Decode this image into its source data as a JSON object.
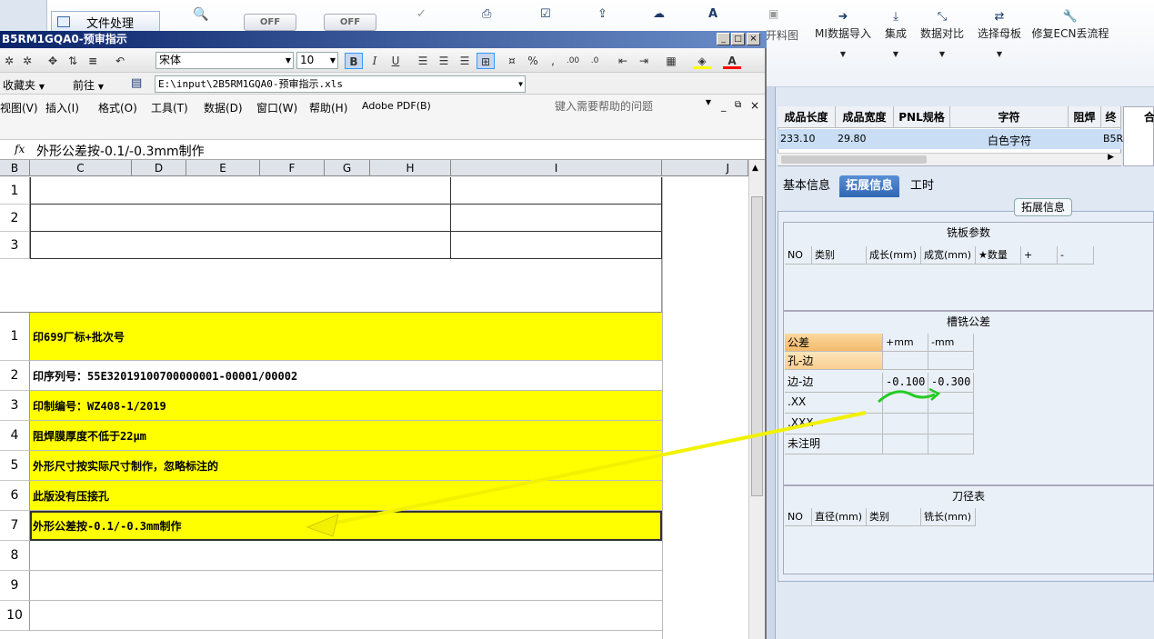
{
  "top_toolbar": {
    "file_button": "文件处理",
    "off_1": "OFF",
    "off_2": "OFF",
    "partial_label": "开料图",
    "buttons": [
      {
        "label": "MI数据导入",
        "icon": "login-icon"
      },
      {
        "label": "集成",
        "icon": "download-icon"
      },
      {
        "label": "数据对比",
        "icon": "compress-icon"
      },
      {
        "label": "选择母板",
        "icon": "shuffle-icon"
      },
      {
        "label": "修复ECN丢流程",
        "icon": "wrench-icon"
      }
    ]
  },
  "excel": {
    "title": "B5RM1GQA0-预审指示",
    "font_name": "宋体",
    "font_size": "10",
    "favorites": "收藏夹",
    "goto": "前往",
    "path": "E:\\input\\2B5RM1GQA0-预审指示.xls",
    "menu": [
      "视图(V)",
      "插入(I)",
      "格式(O)",
      "工具(T)",
      "数据(D)",
      "窗口(W)",
      "帮助(H)",
      "Adobe PDF(B)"
    ],
    "help_placeholder": "键入需要帮助的问题",
    "fx": "fx",
    "formula": "外形公差按-0.1/-0.3mm制作",
    "columns": [
      "B",
      "C",
      "D",
      "E",
      "F",
      "G",
      "H",
      "I",
      "J"
    ],
    "rows_top": [
      "1",
      "2",
      "3"
    ],
    "rows": [
      {
        "num": "1",
        "text": "印699厂标+批次号",
        "yellow": true
      },
      {
        "num": "2",
        "text": "印序列号：55E32019100700000001-00001/00002",
        "yellow": false
      },
      {
        "num": "3",
        "text": "印制编号：WZ408-1/2019",
        "yellow": true
      },
      {
        "num": "4",
        "text": "阻焊膜厚度不低于22μm",
        "yellow": true
      },
      {
        "num": "5",
        "text": "外形尺寸按实际尺寸制作，忽略标注的",
        "yellow": true
      },
      {
        "num": "6",
        "text": "此版没有压接孔",
        "yellow": true
      },
      {
        "num": "7",
        "text": "外形公差按-0.1/-0.3mm制作",
        "yellow": true
      },
      {
        "num": "8",
        "text": "",
        "yellow": false
      },
      {
        "num": "9",
        "text": "",
        "yellow": false
      },
      {
        "num": "10",
        "text": "",
        "yellow": false
      }
    ]
  },
  "right_panel": {
    "grid_headers": [
      "成品长度",
      "成品宽度",
      "PNL规格",
      "字符",
      "阻焊",
      "终"
    ],
    "grid_row": [
      "233.10",
      "29.80",
      "",
      "白色字符",
      "",
      "B5R"
    ],
    "far_right_header": "合",
    "tabs": [
      "基本信息",
      "拓展信息",
      "工时"
    ],
    "section_title": "拓展信息",
    "milling_title": "铣板参数",
    "milling_headers": [
      "NO",
      "类别",
      "成长(mm)",
      "成宽(mm)",
      "★数量",
      "+",
      "-"
    ],
    "tolerance_title": "槽铣公差",
    "tolerance_headers": [
      "公差",
      "+mm",
      "-mm"
    ],
    "tolerance_rows": [
      {
        "label": "孔-边",
        "plus": "",
        "minus": ""
      },
      {
        "label": "边-边",
        "plus": "-0.100",
        "minus": "-0.300"
      },
      {
        "label": ".XX",
        "plus": "",
        "minus": ""
      },
      {
        "label": ".XXX",
        "plus": "",
        "minus": ""
      },
      {
        "label": "未注明",
        "plus": "",
        "minus": ""
      }
    ],
    "knife_title": "刀径表",
    "knife_headers": [
      "NO",
      "直径(mm)",
      "类别",
      "铣长(mm)"
    ]
  }
}
